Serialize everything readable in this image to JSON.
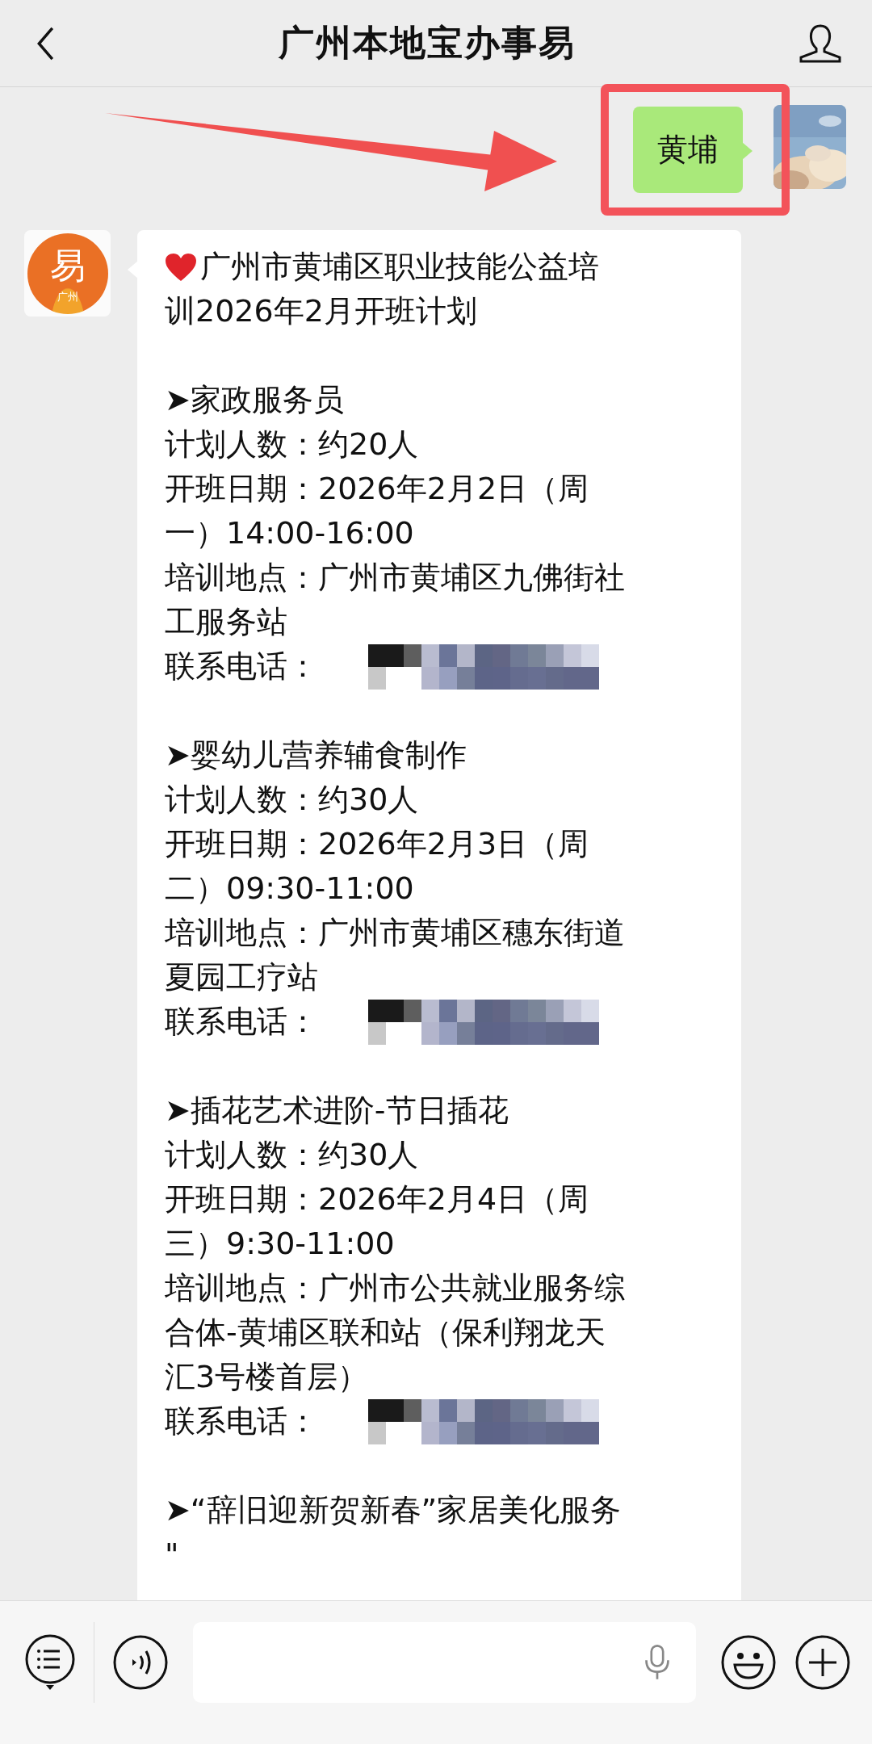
{
  "header": {
    "title": "广州本地宝办事易"
  },
  "messages": [
    {
      "kind": "outgoing",
      "text": "黄埔",
      "highlighted": true
    },
    {
      "kind": "incoming",
      "logo": {
        "glyph": "易",
        "caption": "广州"
      },
      "lines": [
        {
          "kind": "title",
          "text": "广州市黄埔区职业技能公益培"
        },
        {
          "kind": "text",
          "text": "训2026年2月开班计划"
        },
        {
          "kind": "blank"
        },
        {
          "kind": "text",
          "text": "➤家政服务员"
        },
        {
          "kind": "text",
          "text": "计划人数：约20人"
        },
        {
          "kind": "text",
          "text": "开班日期：2026年2月2日（周"
        },
        {
          "kind": "text",
          "text": "一）14:00-16:00"
        },
        {
          "kind": "text",
          "text": "培训地点：广州市黄埔区九佛街社"
        },
        {
          "kind": "text",
          "text": "工服务站"
        },
        {
          "kind": "phone",
          "text": "联系电话："
        },
        {
          "kind": "blank"
        },
        {
          "kind": "text",
          "text": "➤婴幼儿营养辅食制作"
        },
        {
          "kind": "text",
          "text": "计划人数：约30人"
        },
        {
          "kind": "text",
          "text": "开班日期：2026年2月3日（周"
        },
        {
          "kind": "text",
          "text": "二）09:30-11:00"
        },
        {
          "kind": "text",
          "text": "培训地点：广州市黄埔区穗东街道"
        },
        {
          "kind": "text",
          "text": "夏园工疗站"
        },
        {
          "kind": "phone",
          "text": "联系电话："
        },
        {
          "kind": "blank"
        },
        {
          "kind": "text",
          "text": "➤插花艺术进阶-节日插花"
        },
        {
          "kind": "text",
          "text": "计划人数：约30人"
        },
        {
          "kind": "text",
          "text": "开班日期：2026年2月4日（周"
        },
        {
          "kind": "text",
          "text": "三）9:30-11:00"
        },
        {
          "kind": "text",
          "text": "培训地点：广州市公共就业服务综"
        },
        {
          "kind": "text",
          "text": "合体-黄埔区联和站（保利翔龙天"
        },
        {
          "kind": "text",
          "text": "汇3号楼首层）"
        },
        {
          "kind": "phone",
          "text": "联系电话："
        },
        {
          "kind": "blank"
        },
        {
          "kind": "text",
          "text": "➤“辞旧迎新贺新春”家居美化服务"
        },
        {
          "kind": "text",
          "text": "\""
        }
      ]
    }
  ]
}
